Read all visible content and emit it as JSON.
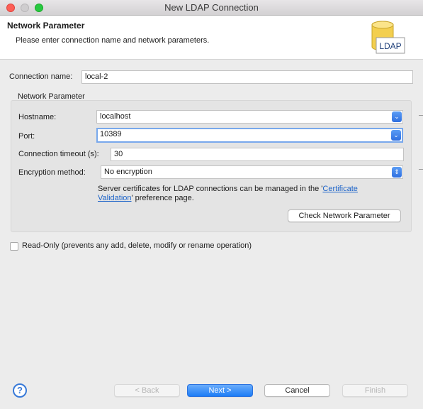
{
  "window": {
    "title": "New LDAP Connection"
  },
  "banner": {
    "title": "Network Parameter",
    "description": "Please enter connection name and network parameters.",
    "icon_label": "LDAP"
  },
  "connection_name": {
    "label": "Connection name:",
    "value": "local-2"
  },
  "network_group": {
    "title": "Network Parameter",
    "hostname": {
      "label": "Hostname:",
      "value": "localhost"
    },
    "port": {
      "label": "Port:",
      "value": "10389"
    },
    "timeout": {
      "label": "Connection timeout (s):",
      "value": "30"
    },
    "encryption": {
      "label": "Encryption method:",
      "value": "No encryption"
    },
    "cert_note": {
      "prefix": "Server certificates for LDAP connections can be managed in the '",
      "link_part1": "Certificate",
      "link_part2": "Validation",
      "suffix": "' preference page."
    },
    "check_button": "Check Network Parameter"
  },
  "read_only": {
    "label": "Read-Only (prevents any add, delete, modify or rename operation)",
    "checked": false
  },
  "footer": {
    "help": "?",
    "back": "< Back",
    "next": "Next >",
    "cancel": "Cancel",
    "finish": "Finish"
  }
}
